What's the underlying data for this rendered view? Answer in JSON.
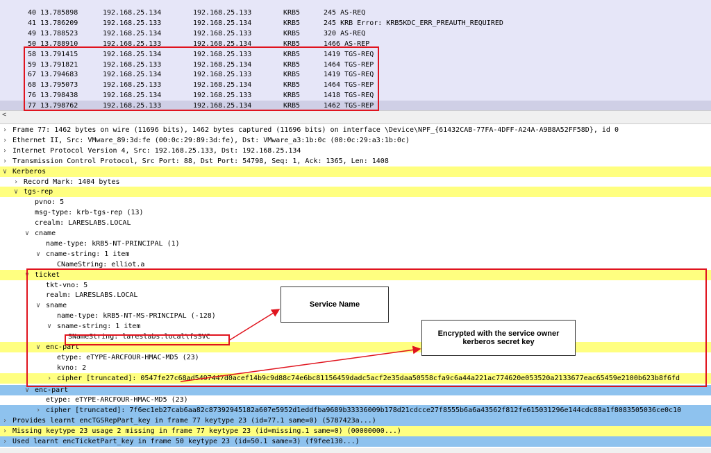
{
  "packet_list": {
    "rows": [
      {
        "no": "40",
        "time": "13.785898",
        "src": "192.168.25.134",
        "dst": "192.168.25.133",
        "proto": "KRB5",
        "info": "245 AS-REQ"
      },
      {
        "no": "41",
        "time": "13.786209",
        "src": "192.168.25.133",
        "dst": "192.168.25.134",
        "proto": "KRB5",
        "info": "245 KRB Error: KRB5KDC_ERR_PREAUTH_REQUIRED"
      },
      {
        "no": "49",
        "time": "13.788523",
        "src": "192.168.25.134",
        "dst": "192.168.25.133",
        "proto": "KRB5",
        "info": "320 AS-REQ"
      },
      {
        "no": "50",
        "time": "13.788910",
        "src": "192.168.25.133",
        "dst": "192.168.25.134",
        "proto": "KRB5",
        "info": "1466 AS-REP"
      },
      {
        "no": "58",
        "time": "13.791415",
        "src": "192.168.25.134",
        "dst": "192.168.25.133",
        "proto": "KRB5",
        "info": "1419 TGS-REQ"
      },
      {
        "no": "59",
        "time": "13.791821",
        "src": "192.168.25.133",
        "dst": "192.168.25.134",
        "proto": "KRB5",
        "info": "1464 TGS-REP"
      },
      {
        "no": "67",
        "time": "13.794683",
        "src": "192.168.25.134",
        "dst": "192.168.25.133",
        "proto": "KRB5",
        "info": "1419 TGS-REQ"
      },
      {
        "no": "68",
        "time": "13.795073",
        "src": "192.168.25.133",
        "dst": "192.168.25.134",
        "proto": "KRB5",
        "info": "1464 TGS-REP"
      },
      {
        "no": "76",
        "time": "13.798438",
        "src": "192.168.25.134",
        "dst": "192.168.25.133",
        "proto": "KRB5",
        "info": "1418 TGS-REQ"
      },
      {
        "no": "77",
        "time": "13.798762",
        "src": "192.168.25.133",
        "dst": "192.168.25.134",
        "proto": "KRB5",
        "info": "1462 TGS-REP"
      }
    ],
    "scroll_arrow": "<"
  },
  "details": [
    {
      "indent": 0,
      "arrow": ">",
      "text": "Frame 77: 1462 bytes on wire (11696 bits), 1462 bytes captured (11696 bits) on interface \\Device\\NPF_{61432CAB-77FA-4DFF-A24A-A9B8A52FF58D}, id 0",
      "hl": ""
    },
    {
      "indent": 0,
      "arrow": ">",
      "text": "Ethernet II, Src: VMware_89:3d:fe (00:0c:29:89:3d:fe), Dst: VMware_a3:1b:0c (00:0c:29:a3:1b:0c)",
      "hl": ""
    },
    {
      "indent": 0,
      "arrow": ">",
      "text": "Internet Protocol Version 4, Src: 192.168.25.133, Dst: 192.168.25.134",
      "hl": ""
    },
    {
      "indent": 0,
      "arrow": ">",
      "text": "Transmission Control Protocol, Src Port: 88, Dst Port: 54798, Seq: 1, Ack: 1365, Len: 1408",
      "hl": ""
    },
    {
      "indent": 0,
      "arrow": "v",
      "text": "Kerberos",
      "hl": "yellow"
    },
    {
      "indent": 1,
      "arrow": ">",
      "text": "Record Mark: 1404 bytes",
      "hl": ""
    },
    {
      "indent": 1,
      "arrow": "v",
      "text": "tgs-rep",
      "hl": "yellow"
    },
    {
      "indent": 2,
      "arrow": "",
      "text": "pvno: 5",
      "hl": ""
    },
    {
      "indent": 2,
      "arrow": "",
      "text": "msg-type: krb-tgs-rep (13)",
      "hl": ""
    },
    {
      "indent": 2,
      "arrow": "",
      "text": "crealm: LARESLABS.LOCAL",
      "hl": ""
    },
    {
      "indent": 2,
      "arrow": "v",
      "text": "cname",
      "hl": ""
    },
    {
      "indent": 3,
      "arrow": "",
      "text": "name-type: kRB5-NT-PRINCIPAL (1)",
      "hl": ""
    },
    {
      "indent": 3,
      "arrow": "v",
      "text": "cname-string: 1 item",
      "hl": ""
    },
    {
      "indent": 4,
      "arrow": "",
      "text": "CNameString: elliot.a",
      "hl": ""
    },
    {
      "indent": 2,
      "arrow": "v",
      "text": "ticket",
      "hl": "yellow"
    },
    {
      "indent": 3,
      "arrow": "",
      "text": "tkt-vno: 5",
      "hl": ""
    },
    {
      "indent": 3,
      "arrow": "",
      "text": "realm: LARESLABS.LOCAL",
      "hl": ""
    },
    {
      "indent": 3,
      "arrow": "v",
      "text": "sname",
      "hl": ""
    },
    {
      "indent": 4,
      "arrow": "",
      "text": "name-type: kRB5-NT-MS-PRINCIPAL (-128)",
      "hl": ""
    },
    {
      "indent": 4,
      "arrow": "v",
      "text": "sname-string: 1 item",
      "hl": ""
    },
    {
      "indent": 5,
      "arrow": "",
      "text": "SNameString: lareslabs.local\\fsSVC",
      "hl": ""
    },
    {
      "indent": 3,
      "arrow": "v",
      "text": "enc-part",
      "hl": "yellow"
    },
    {
      "indent": 4,
      "arrow": "",
      "text": "etype: eTYPE-ARCFOUR-HMAC-MD5 (23)",
      "hl": ""
    },
    {
      "indent": 4,
      "arrow": "",
      "text": "kvno: 2",
      "hl": ""
    },
    {
      "indent": 4,
      "arrow": ">",
      "text": "cipher [truncated]: 0547fe27c68ad5497447d0acef14b9c9d88c74e6bc81156459dadc5acf2e35daa50558cfa9c6a44a221ac774620e053520a2133677eac65459e2100b623b8f6fd",
      "hl": "yellow"
    },
    {
      "indent": 2,
      "arrow": "v",
      "text": "enc-part",
      "hl": "blue"
    },
    {
      "indent": 3,
      "arrow": "",
      "text": "etype: eTYPE-ARCFOUR-HMAC-MD5 (23)",
      "hl": ""
    },
    {
      "indent": 3,
      "arrow": ">",
      "text": "cipher [truncated]: 7f6ec1eb27cab6aa82c87392945182a607e5952d1eddfba9689b33336009b178d21cdcce27f8555b6a6a43562f812fe615031296e144cdc88a1f8083505036ce0c10",
      "hl": "blue"
    },
    {
      "indent": 0,
      "arrow": ">",
      "text": "Provides learnt encTGSRepPart_key in frame 77 keytype 23 (id=77.1 same=0) (5787423a...)",
      "hl": "blue"
    },
    {
      "indent": 0,
      "arrow": ">",
      "text": "Missing keytype 23 usage 2 missing in frame 77 keytype 23 (id=missing.1 same=0) (00000000...)",
      "hl": "yellow"
    },
    {
      "indent": 0,
      "arrow": ">",
      "text": "Used learnt encTicketPart_key in frame 50 keytype 23 (id=50.1 same=3) (f9fee130...)",
      "hl": "blue"
    }
  ],
  "annotations": {
    "service_name": "Service Name",
    "encrypted_line1": "Encrypted with the service owner",
    "encrypted_line2": "kerberos secret key"
  },
  "colors": {
    "highlight_yellow": "#ffff80",
    "highlight_blue": "#8ec2ee",
    "annotation_red": "#e0141e"
  }
}
